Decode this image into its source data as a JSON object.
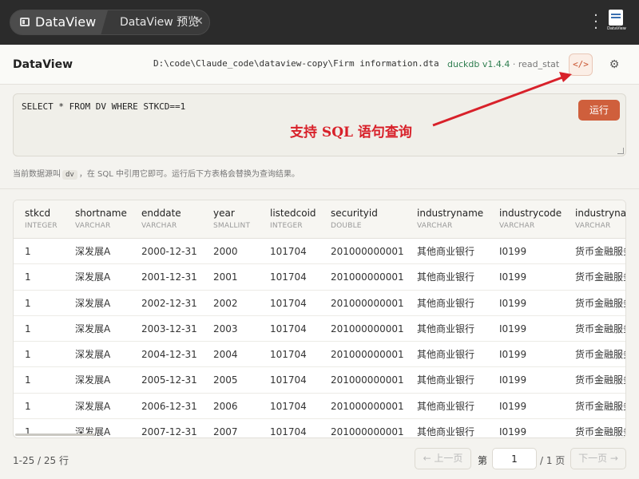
{
  "tabs": {
    "active_label": "DataView",
    "second_label": "DataView 预览",
    "close_glyph": "✕"
  },
  "app_logo_text": "DataView",
  "header": {
    "title": "DataView",
    "file_path": "D:\\code\\Claude_code\\dataview-copy\\Firm information.dta",
    "engine_name": "duckdb v1.4.4",
    "engine_reader": " · read_stat ✓",
    "sql_toggle_label": "</>",
    "settings_icon": "⚙"
  },
  "sql": {
    "query": "SELECT * FROM DV WHERE STKCD==1",
    "run_label": "运行",
    "annotation": "支持 SQL 语句查询",
    "hint_before": "当前数据源叫",
    "hint_code": "dv",
    "hint_after": "，在 SQL 中引用它即可。运行后下方表格会替换为查询结果。"
  },
  "table": {
    "columns": [
      {
        "name": "stkcd",
        "type": "INTEGER"
      },
      {
        "name": "shortname",
        "type": "VARCHAR"
      },
      {
        "name": "enddate",
        "type": "VARCHAR"
      },
      {
        "name": "year",
        "type": "SMALLINT"
      },
      {
        "name": "listedcoid",
        "type": "INTEGER"
      },
      {
        "name": "securityid",
        "type": "DOUBLE"
      },
      {
        "name": "industryname",
        "type": "VARCHAR"
      },
      {
        "name": "industrycode",
        "type": "VARCHAR"
      },
      {
        "name": "industryname",
        "type": "VARCHAR"
      }
    ],
    "rows": [
      [
        "1",
        "深发展A",
        "2000-12-31",
        "2000",
        "101704",
        "201000000001",
        "其他商业银行",
        "I0199",
        "货币金融服务"
      ],
      [
        "1",
        "深发展A",
        "2001-12-31",
        "2001",
        "101704",
        "201000000001",
        "其他商业银行",
        "I0199",
        "货币金融服务"
      ],
      [
        "1",
        "深发展A",
        "2002-12-31",
        "2002",
        "101704",
        "201000000001",
        "其他商业银行",
        "I0199",
        "货币金融服务"
      ],
      [
        "1",
        "深发展A",
        "2003-12-31",
        "2003",
        "101704",
        "201000000001",
        "其他商业银行",
        "I0199",
        "货币金融服务"
      ],
      [
        "1",
        "深发展A",
        "2004-12-31",
        "2004",
        "101704",
        "201000000001",
        "其他商业银行",
        "I0199",
        "货币金融服务"
      ],
      [
        "1",
        "深发展A",
        "2005-12-31",
        "2005",
        "101704",
        "201000000001",
        "其他商业银行",
        "I0199",
        "货币金融服务"
      ],
      [
        "1",
        "深发展A",
        "2006-12-31",
        "2006",
        "101704",
        "201000000001",
        "其他商业银行",
        "I0199",
        "货币金融服务"
      ],
      [
        "1",
        "深发展A",
        "2007-12-31",
        "2007",
        "101704",
        "201000000001",
        "其他商业银行",
        "I0199",
        "货币金融服务"
      ]
    ]
  },
  "pagination": {
    "range_text": "1-25 / 25 行",
    "prev_label": "← 上一页",
    "page_label": "第",
    "current_page": "1",
    "total_label": "/ 1 页",
    "next_label": "下一页 →"
  },
  "colors": {
    "accent": "#cf5f3c",
    "annotation": "#d8212a",
    "engine": "#2e7d4f",
    "topbar": "#2b2b2b"
  }
}
